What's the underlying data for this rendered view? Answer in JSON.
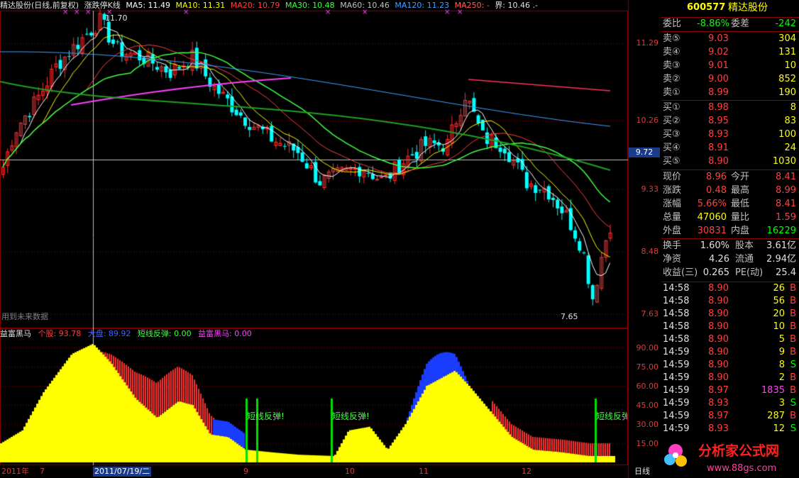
{
  "header": {
    "title": "精达股份(日线,前复权)",
    "indicator": "涨跌停K线",
    "ma5": "MA5: 11.49",
    "ma10": "MA10: 11.31",
    "ma20": "MA20: 10.79",
    "ma30": "MA30: 10.48",
    "ma60": "MA60: 10.46",
    "ma120": "MA120: 11.23",
    "ma250": "MA250: -",
    "jie": "界: 10.46 .-"
  },
  "colors": {
    "ma5": "#ffffff",
    "ma10": "#ffff00",
    "ma20": "#ff4040",
    "ma30": "#40ff40",
    "ma60": "#c0c0c0",
    "ma120": "#40a0ff",
    "ma250": "#ff6060",
    "up": "#ff3030",
    "down": "#00ffff",
    "grid": "#8b0000",
    "yellow": "#ffff00",
    "blue": "#1a3cff"
  },
  "price_axis": {
    "ticks": [
      "11.29",
      "10.26",
      "9.33",
      "8.48",
      "7.63"
    ],
    "cursor": "9.72",
    "high_label": "11.70",
    "low_label": "7.65"
  },
  "indicator_header": {
    "name": "益富黑马",
    "geg": "个股: 93.78",
    "dap": "大盘: 89.92",
    "dxft": "短线反弹: 0.00",
    "yfhm": "益富黑马: 0.00"
  },
  "indicator_axis": {
    "ticks": [
      "90.00",
      "75.00",
      "60.00",
      "45.00",
      "30.00",
      "15.00"
    ]
  },
  "indicator_labels": {
    "a": "短线反弹!",
    "b": "短线反弹!",
    "c": "短线反弹!",
    "d": "短线反弹"
  },
  "future_text": "用到未来数据",
  "x_axis": {
    "labels": [
      "2011年",
      "7",
      "2011/07/19/二",
      "9",
      "10",
      "11",
      "12"
    ],
    "period": "日线"
  },
  "quote": {
    "code": "600577",
    "name": "精达股份",
    "weibi_l": "委比",
    "weibi": "-8.86%",
    "weicha_l": "委差",
    "weicha": "-242",
    "sell": [
      {
        "l": "卖⑤",
        "p": "9.03",
        "v": "304"
      },
      {
        "l": "卖④",
        "p": "9.02",
        "v": "131"
      },
      {
        "l": "卖③",
        "p": "9.01",
        "v": "10"
      },
      {
        "l": "卖②",
        "p": "9.00",
        "v": "852"
      },
      {
        "l": "卖①",
        "p": "8.99",
        "v": "190"
      }
    ],
    "buy": [
      {
        "l": "买①",
        "p": "8.98",
        "v": "8"
      },
      {
        "l": "买②",
        "p": "8.95",
        "v": "83"
      },
      {
        "l": "买③",
        "p": "8.93",
        "v": "100"
      },
      {
        "l": "买④",
        "p": "8.91",
        "v": "24"
      },
      {
        "l": "买⑤",
        "p": "8.90",
        "v": "1030"
      }
    ],
    "stats": [
      {
        "a": "现价",
        "b": "8.96",
        "c": "今开",
        "d": "8.41",
        "bc": "#ff4040",
        "dc": "#ff4040"
      },
      {
        "a": "涨跌",
        "b": "0.48",
        "c": "最高",
        "d": "8.99",
        "bc": "#ff4040",
        "dc": "#ff4040"
      },
      {
        "a": "涨幅",
        "b": "5.66%",
        "c": "最低",
        "d": "8.41",
        "bc": "#ff4040",
        "dc": "#ff4040"
      },
      {
        "a": "总量",
        "b": "47060",
        "c": "量比",
        "d": "1.59",
        "bc": "#ffff00",
        "dc": "#ff4040"
      },
      {
        "a": "外盘",
        "b": "30831",
        "c": "内盘",
        "d": "16229",
        "bc": "#ff4040",
        "dc": "#00ff00"
      }
    ],
    "stats2": [
      {
        "a": "换手",
        "b": "1.60%",
        "c": "股本",
        "d": "3.61亿"
      },
      {
        "a": "净资",
        "b": "4.26",
        "c": "流通",
        "d": "2.94亿"
      },
      {
        "a": "收益(三)",
        "b": "0.265",
        "c": "PE(动)",
        "d": "25.4"
      }
    ],
    "ticks": [
      {
        "t": "14:58",
        "p": "8.90",
        "v": "26",
        "s": "B"
      },
      {
        "t": "14:58",
        "p": "8.90",
        "v": "56",
        "s": "B"
      },
      {
        "t": "14:58",
        "p": "8.90",
        "v": "20",
        "s": "B"
      },
      {
        "t": "14:58",
        "p": "8.90",
        "v": "10",
        "s": "B"
      },
      {
        "t": "14:58",
        "p": "8.90",
        "v": "5",
        "s": "B"
      },
      {
        "t": "14:59",
        "p": "8.90",
        "v": "9",
        "s": "B"
      },
      {
        "t": "14:59",
        "p": "8.90",
        "v": "8",
        "s": "S"
      },
      {
        "t": "14:59",
        "p": "8.90",
        "v": "2",
        "s": "B"
      },
      {
        "t": "14:59",
        "p": "8.97",
        "v": "1835",
        "s": "B"
      },
      {
        "t": "14:59",
        "p": "8.93",
        "v": "3",
        "s": "S"
      },
      {
        "t": "14:59",
        "p": "8.97",
        "v": "287",
        "s": "B"
      },
      {
        "t": "14:59",
        "p": "8.93",
        "v": "12",
        "s": "S"
      }
    ]
  },
  "watermark": {
    "brand": "分析家公式网",
    "url": "www.88gs.com"
  }
}
